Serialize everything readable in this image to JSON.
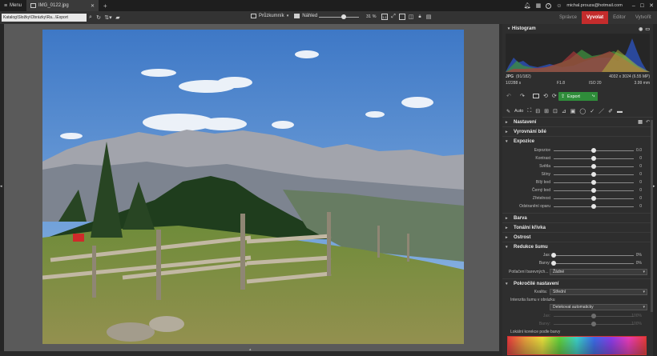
{
  "topbar": {
    "menu_label": "Menu",
    "tab_title": "IMG_0122.jpg",
    "new_tab": "+",
    "account": "michal.prouza@hotmail.com"
  },
  "toolbar": {
    "path": "Katalog\\Složky\\Obrázky\\Ra...\\Export",
    "browser_label": "Průzkumník",
    "preview_label": "Náhled",
    "zoom_value": 0.62,
    "zoom_text": "31 %",
    "modes": [
      {
        "label": "Správce",
        "active": false
      },
      {
        "label": "Vyvolat",
        "active": true
      },
      {
        "label": "Editor",
        "active": false
      },
      {
        "label": "Vytvořit",
        "active": false
      }
    ]
  },
  "panel": {
    "histogram_title": "Histogram",
    "file_type": "JPG",
    "file_index": "(91/182)",
    "dimensions": "4032 x 3024 (6.55 MP)",
    "exposure_time": "1/2288 s",
    "aperture": "F1.8",
    "iso": "ISO 20",
    "focal": "3.99 mm",
    "auto_label": "Auto",
    "export_label": "Export",
    "sections": {
      "settings": "Nastavení",
      "white_balance": "Vyrovnání bílé",
      "exposure": "Expozice",
      "color": "Barva",
      "tone_curve": "Tonální křivka",
      "sharpness": "Ostrost",
      "noise": "Redukce šumu",
      "advanced": "Pokročilé nastavení"
    },
    "exposure_sliders": [
      {
        "label": "Expozice",
        "value": "0.0",
        "pos": 0.5
      },
      {
        "label": "Kontrast",
        "value": "0",
        "pos": 0.5
      },
      {
        "label": "Světla",
        "value": "0",
        "pos": 0.5
      },
      {
        "label": "Stíny",
        "value": "0",
        "pos": 0.5
      },
      {
        "label": "Bílý bod",
        "value": "0",
        "pos": 0.5
      },
      {
        "label": "Černý bod",
        "value": "0",
        "pos": 0.5
      },
      {
        "label": "Zřetelnost",
        "value": "0",
        "pos": 0.5
      },
      {
        "label": "Odstranění oparu",
        "value": "0",
        "pos": 0.5
      }
    ],
    "noise_sliders": [
      {
        "label": "Jas:",
        "value": "0%",
        "pos": 0.0
      },
      {
        "label": "Barvy:",
        "value": "0%",
        "pos": 0.0
      }
    ],
    "suppress_label": "Potlačení barevných...",
    "suppress_value": "Žádné",
    "quality_label": "Kvalita:",
    "quality_value": "Střední",
    "intensity_label": "Intenzita šumu v obrázku",
    "intensity_value": "Detekovat automaticky",
    "dim_sliders": [
      {
        "label": "Jas:",
        "value": "100%"
      },
      {
        "label": "Barvy:",
        "value": "100%"
      }
    ],
    "local_label": "Lokální korekce podle barvy"
  }
}
